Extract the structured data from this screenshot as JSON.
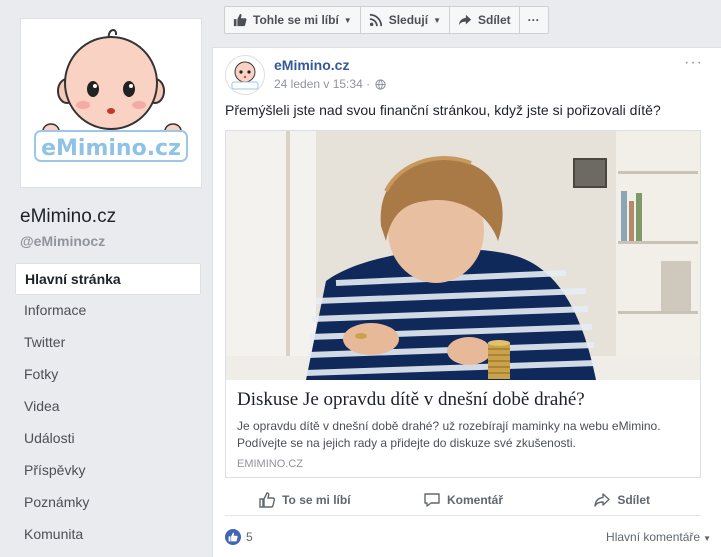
{
  "sidebar": {
    "logo_text": "eMimino.cz",
    "page_name": "eMimino.cz",
    "handle": "@eMiminocz",
    "items": [
      {
        "label": "Hlavní stránka"
      },
      {
        "label": "Informace"
      },
      {
        "label": "Twitter"
      },
      {
        "label": "Fotky"
      },
      {
        "label": "Videa"
      },
      {
        "label": "Události"
      },
      {
        "label": "Příspěvky"
      },
      {
        "label": "Poznámky"
      },
      {
        "label": "Komunita"
      }
    ]
  },
  "top_actions": {
    "like_label": "Tohle se mi líbí",
    "follow_label": "Sledují",
    "share_label": "Sdílet",
    "more_label": "···"
  },
  "post": {
    "author": "eMimino.cz",
    "timestamp": "24 leden v 15:34 ·",
    "text": "Přemýšleli jste nad svou finanční stránkou, když jste si pořizovali dítě?",
    "more_label": "···",
    "link": {
      "title": "Diskuse Je opravdu dítě v dnešní době drahé?",
      "description": "Je opravdu dítě v dnešní době drahé? už rozebírají maminky na webu eMimino. Podívejte se na jejich rady a přidejte do diskuze své zkušenosti.",
      "domain": "EMIMINO.CZ"
    },
    "actions": {
      "like": "To se mi líbí",
      "comment": "Komentář",
      "share": "Sdílet"
    },
    "likes_count": "5",
    "comment_sort": "Hlavní komentáře"
  },
  "colors": {
    "brand_blue": "#365899",
    "like_blue": "#4267b2",
    "background": "#e9ebee"
  },
  "icons": [
    "thumbs-up-icon",
    "rss-icon",
    "share-arrow-icon",
    "globe-icon",
    "comment-icon"
  ]
}
